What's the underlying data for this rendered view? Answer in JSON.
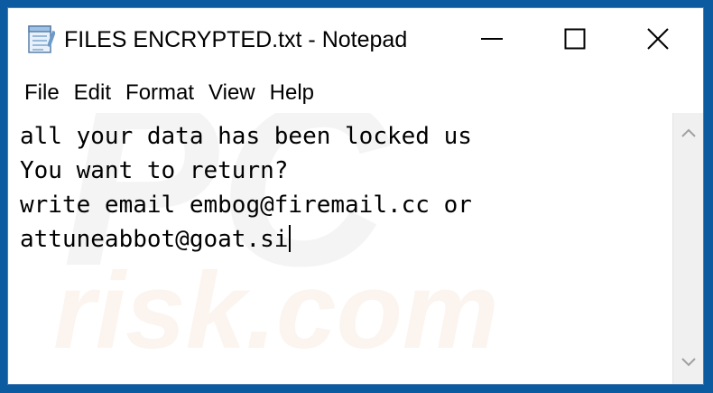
{
  "window": {
    "title": "FILES ENCRYPTED.txt - Notepad",
    "app_icon": "notepad-icon",
    "controls": {
      "minimize_icon": "minimize-icon",
      "maximize_icon": "maximize-icon",
      "close_icon": "close-icon"
    }
  },
  "menu": {
    "items": [
      "File",
      "Edit",
      "Format",
      "View",
      "Help"
    ]
  },
  "editor": {
    "lines": [
      "all your data has been locked us",
      "You want to return?",
      "write email embog@firemail.cc or",
      "attuneabbot@goat.si"
    ]
  },
  "watermark": {
    "text_top": "PC",
    "text_bottom": "risk.com"
  },
  "colors": {
    "frame_background": "#0c5aa0",
    "window_background": "#ffffff",
    "scrollbar": "#f0f0f0"
  }
}
